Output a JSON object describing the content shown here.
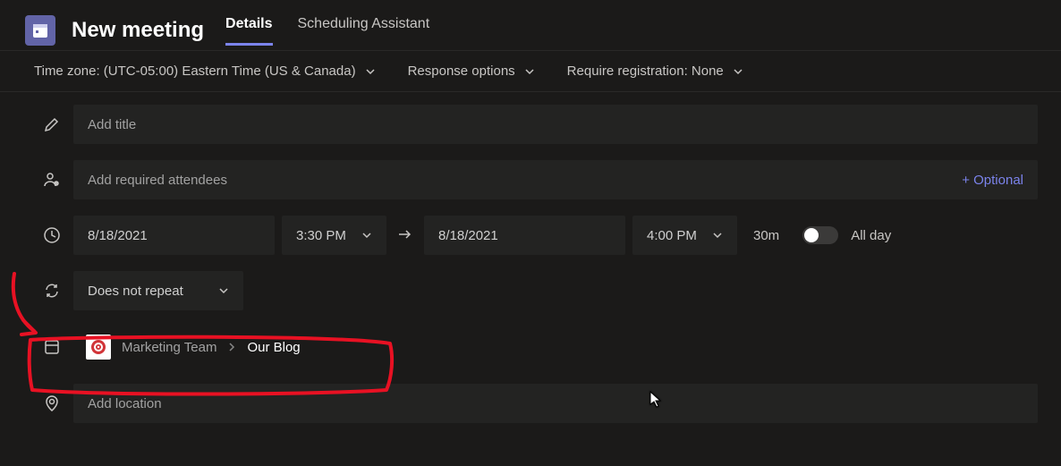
{
  "header": {
    "title": "New meeting",
    "tabs": {
      "details": "Details",
      "scheduling": "Scheduling Assistant"
    }
  },
  "optionBar": {
    "timezone": "Time zone: (UTC-05:00) Eastern Time (US & Canada)",
    "response": "Response options",
    "registration": "Require registration: None"
  },
  "form": {
    "title_placeholder": "Add title",
    "attendees_placeholder": "Add required attendees",
    "optional_label": "+ Optional",
    "start_date": "8/18/2021",
    "start_time": "3:30 PM",
    "end_date": "8/18/2021",
    "end_time": "4:00 PM",
    "duration": "30m",
    "allday_label": "All day",
    "repeat": "Does not repeat",
    "channel_team": "Marketing Team",
    "channel_name": "Our Blog",
    "location_placeholder": "Add location"
  },
  "icons": {
    "app": "calendar",
    "pencil": "edit",
    "people": "attendees",
    "clock": "time",
    "repeat": "recurrence",
    "channel": "channel",
    "location": "location",
    "chevron_down": "chevron-down",
    "arrow_right": "arrow-right",
    "target": "target-bullseye"
  }
}
